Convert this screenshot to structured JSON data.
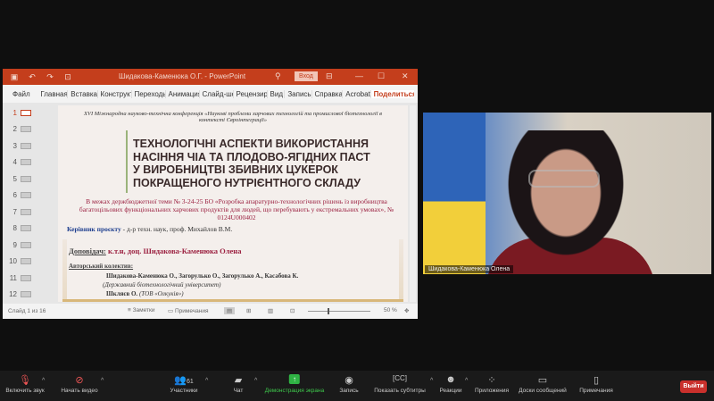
{
  "ppt": {
    "title": "Шидакова-Каменюка О.Г. - PowerPoint",
    "login": "Вход",
    "tabs": [
      "Файл",
      "Главная",
      "Вставка",
      "Конструктор",
      "Переходы",
      "Анимация",
      "Слайд-шоу",
      "Рецензирование",
      "Вид",
      "Запись",
      "Справка",
      "Acrobat"
    ],
    "share": "Поделиться",
    "thumbs": [
      "1",
      "2",
      "3",
      "4",
      "5",
      "6",
      "7",
      "8",
      "9",
      "10",
      "11",
      "12"
    ],
    "status": {
      "slide": "Слайд 1 из 16",
      "notes": "Заметки",
      "comments": "Примечания",
      "zoom": "50 %"
    },
    "zoom_fraction": 0.5
  },
  "slide": {
    "conference": "XVI Міжнародна науково-технічна конференція «Наукові проблеми харчових технологій та промислової біотехнології в контексті Євроінтеграції»",
    "title_lines": [
      "ТЕХНОЛОГІЧНІ АСПЕКТИ ВИКОРИСТАННЯ",
      "НАСІННЯ ЧІА ТА ПЛОДОВО-ЯГІДНИХ ПАСТ",
      "У ВИРОБНИЦТВІ ЗБИВНИХ ЦУКЕРОК",
      "ПОКРАЩЕНОГО НУТРІЄНТНОГО СКЛАДУ"
    ],
    "theme": "В межах держбюджетної теми № 3-24-25 БО «Розробка апаратурно-технологічних рішень із виробництва багатоцільових функціональних харчових продуктів для людей, що перебувають у екстремальних умовах», № 0124U000402",
    "lead_label": "Керівник проєкту",
    "lead_text": " - д-р техн. наук, проф. Михайлов В.М.",
    "reporter_label": "Доповідач:",
    "reporter_text": " к.т.н, доц. Шидакова-Каменюка Олена",
    "authors_label": "Авторський колектив:",
    "authors": "Шидакова-Каменюка О., Загорулько О., Загорулько А., Касабова К.",
    "affil": "(Державний біотехнологічний університет)",
    "author2": "Шкляєв О.",
    "affil2": " (ТОВ «Олкукія»)"
  },
  "video": {
    "name": "Шидакова-Каменюка Олена"
  },
  "toolbar": {
    "mute": "Включить звук",
    "video": "Начать видео",
    "participants": "Участники",
    "count": "61",
    "chat": "Чат",
    "share": "Демонстрация экрана",
    "record": "Запись",
    "captions": "Показать субтитры",
    "reactions": "Реакции",
    "apps": "Приложения",
    "whiteboards": "Доски сообщений",
    "notes": "Примечания",
    "leave": "Выйти"
  }
}
